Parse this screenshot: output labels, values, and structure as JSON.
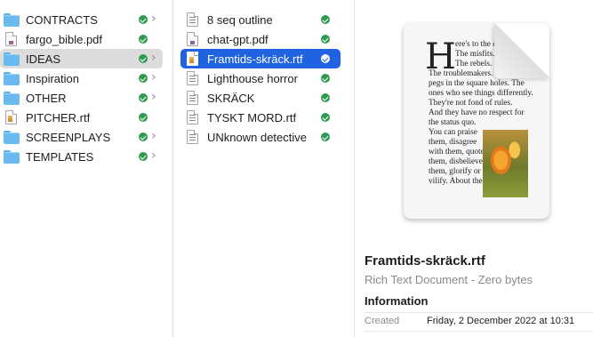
{
  "colors": {
    "selection_blue": "#1f63e0",
    "selection_grey": "#dcdcdc",
    "synced_green": "#2e9a4e",
    "folder_blue": "#6ab9ef"
  },
  "folders_column": [
    {
      "name": "CONTRACTS",
      "icon": "folder-icon",
      "has_chevron": true
    },
    {
      "name": "fargo_bible.pdf",
      "icon": "pdf-file-icon",
      "has_chevron": false
    },
    {
      "name": "IDEAS",
      "icon": "folder-icon",
      "has_chevron": true,
      "selected": true
    },
    {
      "name": "Inspiration",
      "icon": "folder-icon",
      "has_chevron": true
    },
    {
      "name": "OTHER",
      "icon": "folder-icon",
      "has_chevron": true
    },
    {
      "name": "PITCHER.rtf",
      "icon": "rtf-file-icon",
      "has_chevron": false
    },
    {
      "name": "SCREENPLAYS",
      "icon": "folder-icon",
      "has_chevron": true
    },
    {
      "name": "TEMPLATES",
      "icon": "folder-icon",
      "has_chevron": true
    }
  ],
  "files_column": [
    {
      "name": "8 seq outline",
      "icon": "document-icon"
    },
    {
      "name": "chat-gpt.pdf",
      "icon": "pdf-file-icon"
    },
    {
      "name": "Framtids-skräck.rtf",
      "icon": "rtf-file-icon",
      "selected": true
    },
    {
      "name": "Lighthouse horror",
      "icon": "document-icon"
    },
    {
      "name": "SKRÄCK",
      "icon": "document-icon"
    },
    {
      "name": "TYSKT MORD.rtf",
      "icon": "document-icon"
    },
    {
      "name": "UNknown detective",
      "icon": "document-icon"
    }
  ],
  "preview": {
    "icon_text": {
      "drop_cap": "H",
      "lines": [
        "ere's to the crazy",
        "The misfits.",
        "The rebels.",
        "The troublemakers. The round",
        "pegs in the square holes. The",
        "ones who see things differently.",
        "They're not fond of rules.",
        "And they have no respect for",
        "the status quo.",
        "You can praise",
        "them, disagree",
        "with them, quote",
        "them, disbelieve",
        "them, glorify or",
        "vilify. About the"
      ]
    },
    "file_name": "Framtids-skräck.rtf",
    "file_kind": "Rich Text Document - Zero bytes",
    "information_heading": "Information",
    "created_label": "Created",
    "created_value": "Friday, 2 December 2022 at 10:31"
  }
}
